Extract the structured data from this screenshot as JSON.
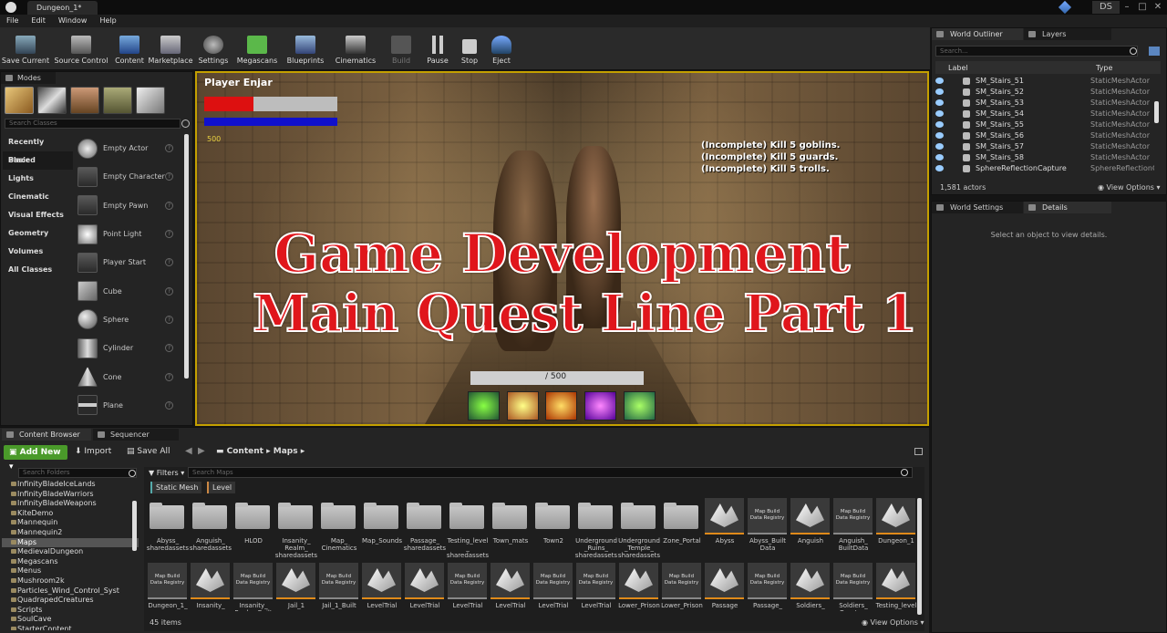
{
  "window": {
    "tab": "Dungeon_1*",
    "user": "DS",
    "min": "–",
    "max": "□",
    "close": "✕"
  },
  "menu": [
    "File",
    "Edit",
    "Window",
    "Help"
  ],
  "toolbar": [
    "Save Current",
    "Source Control",
    "Content",
    "Marketplace",
    "Settings",
    "Megascans",
    "Blueprints",
    "Cinematics",
    "Build",
    "Pause",
    "Stop",
    "Eject"
  ],
  "modes": {
    "tab": "Modes",
    "search_placeholder": "Search Classes",
    "categories": [
      "Recently Placed",
      "Basic",
      "Lights",
      "Cinematic",
      "Visual Effects",
      "Geometry",
      "Volumes",
      "All Classes"
    ],
    "items": [
      "Empty Actor",
      "Empty Character",
      "Empty Pawn",
      "Point Light",
      "Player Start",
      "Cube",
      "Sphere",
      "Cylinder",
      "Cone",
      "Plane"
    ],
    "help_glyph": "?"
  },
  "game": {
    "player_name": "Player Enjar",
    "health_fraction": 0.37,
    "mana_fraction": 1.0,
    "score": "500",
    "quests": [
      "(Incomplete) Kill 5 goblins.",
      "(Incomplete) Kill 5 guards.",
      "(Incomplete) Kill 5 trolls."
    ],
    "xp_text": "/ 500",
    "overlay_line1": "Game Development",
    "overlay_line2": "Main Quest Line Part 1",
    "colors": {
      "health": "#dd1010",
      "mana": "#1010cc",
      "overlay": "#e0161c"
    }
  },
  "outliner": {
    "tabs": [
      "World Outliner",
      "Layers"
    ],
    "search_placeholder": "Search...",
    "col_label": "Label",
    "col_type": "Type",
    "rows": [
      {
        "label": "SM_Stairs_51",
        "type": "StaticMeshActor"
      },
      {
        "label": "SM_Stairs_52",
        "type": "StaticMeshActor"
      },
      {
        "label": "SM_Stairs_53",
        "type": "StaticMeshActor"
      },
      {
        "label": "SM_Stairs_54",
        "type": "StaticMeshActor"
      },
      {
        "label": "SM_Stairs_55",
        "type": "StaticMeshActor"
      },
      {
        "label": "SM_Stairs_56",
        "type": "StaticMeshActor"
      },
      {
        "label": "SM_Stairs_57",
        "type": "StaticMeshActor"
      },
      {
        "label": "SM_Stairs_58",
        "type": "StaticMeshActor"
      },
      {
        "label": "SphereReflectionCapture",
        "type": "SphereReflectionC"
      }
    ],
    "count": "1,581 actors",
    "view_options": "View Options"
  },
  "details": {
    "tabs": [
      "World Settings",
      "Details"
    ],
    "empty": "Select an object to view details."
  },
  "content_browser": {
    "tabs": [
      "Content Browser",
      "Sequencer"
    ],
    "add_new": "Add New",
    "import": "Import",
    "save_all": "Save All",
    "breadcrumb": [
      "Content",
      "Maps"
    ],
    "search_folders": "Search Folders",
    "folders": [
      "InfinityBladeIceLands",
      "InfinityBladeWarriors",
      "InfinityBladeWeapons",
      "KiteDemo",
      "Mannequin",
      "Mannequin2",
      "Maps",
      "MedievalDungeon",
      "Megascans",
      "Menus",
      "Mushroom2k",
      "Particles_Wind_Control_Syst",
      "QuadrapedCreatures",
      "Scripts",
      "SoulCave",
      "StarterContent"
    ],
    "filters": "Filters",
    "search_maps": "Search Maps",
    "filter_chips": [
      "Static Mesh",
      "Level"
    ],
    "row1": [
      {
        "kind": "folder",
        "label": "Abyss_ sharedassets"
      },
      {
        "kind": "folder",
        "label": "Anguish_ sharedassets"
      },
      {
        "kind": "folder",
        "label": "HLOD"
      },
      {
        "kind": "folder",
        "label": "Insanity_ Realm_ sharedassets"
      },
      {
        "kind": "folder",
        "label": "Map_ Cinematics"
      },
      {
        "kind": "folder",
        "label": "Map_Sounds"
      },
      {
        "kind": "folder",
        "label": "Passage_ sharedassets"
      },
      {
        "kind": "folder",
        "label": "Testing_level _ sharedassets"
      },
      {
        "kind": "folder",
        "label": "Town_mats"
      },
      {
        "kind": "folder",
        "label": "Town2"
      },
      {
        "kind": "folder",
        "label": "Underground _Ruins_ sharedassets"
      },
      {
        "kind": "folder",
        "label": "Underground _Temple_ sharedassets"
      },
      {
        "kind": "folder",
        "label": "Zone_Portal"
      },
      {
        "kind": "map",
        "label": "Abyss"
      },
      {
        "kind": "registry",
        "label": "Abyss_Built Data"
      },
      {
        "kind": "map",
        "label": "Anguish"
      },
      {
        "kind": "registry",
        "label": "Anguish_ BuiltData"
      },
      {
        "kind": "map",
        "label": "Dungeon_1"
      }
    ],
    "row2": [
      {
        "kind": "registry",
        "label": "Dungeon_1_"
      },
      {
        "kind": "map",
        "label": "Insanity_"
      },
      {
        "kind": "registry",
        "label": "Insanity_ Realm_Built"
      },
      {
        "kind": "map",
        "label": "Jail_1"
      },
      {
        "kind": "registry",
        "label": "Jail_1_Built"
      },
      {
        "kind": "map",
        "label": "LevelTrial"
      },
      {
        "kind": "map",
        "label": "LevelTrial"
      },
      {
        "kind": "registry",
        "label": "LevelTrial"
      },
      {
        "kind": "map",
        "label": "LevelTrial"
      },
      {
        "kind": "registry",
        "label": "LevelTrial"
      },
      {
        "kind": "registry",
        "label": "LevelTrial"
      },
      {
        "kind": "map",
        "label": "Lower_Prison"
      },
      {
        "kind": "registry",
        "label": "Lower_Prison"
      },
      {
        "kind": "map",
        "label": "Passage"
      },
      {
        "kind": "registry",
        "label": "Passage_"
      },
      {
        "kind": "map",
        "label": "Soldiers_"
      },
      {
        "kind": "registry",
        "label": "Soldiers_ Quarters"
      },
      {
        "kind": "map",
        "label": "Testing_level"
      }
    ],
    "registry_text": "Map Build Data Registry",
    "count": "45 items",
    "view_options": "View Options"
  }
}
